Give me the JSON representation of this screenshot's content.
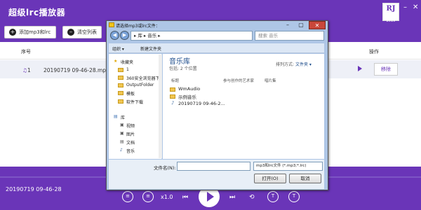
{
  "app": {
    "title": "超级lrc播放器",
    "logo": "RJ",
    "logo_year": "2019",
    "minimize": "–",
    "close": "✕"
  },
  "toolbar": {
    "add_label": "添加mp3和lrc",
    "clear_label": "清空列表"
  },
  "list": {
    "headers": {
      "index": "序号",
      "action": "操作"
    },
    "rows": [
      {
        "index": "1",
        "name": "20190719 09-46-28.mp3",
        "action": "移除"
      }
    ]
  },
  "player": {
    "now_playing": "20190719 09-46-28",
    "speed": "x1.0"
  },
  "dialog": {
    "title": "请选择mp3或lrc文件：",
    "nav_path": "▸ 库 ▸ 音乐 ▸",
    "search_placeholder": "搜索 音乐",
    "commands": {
      "organize": "组织 ▾",
      "new_folder": "新建文件夹"
    },
    "nav_items": {
      "favorites": "收藏夹",
      "item1": "1",
      "item2": "360安全浏览器下",
      "item3": "OutputFolder",
      "item4": "模板",
      "item5": "软件下载",
      "libraries": "库",
      "videos": "视频",
      "pictures": "图片",
      "documents": "文档",
      "music": "音乐"
    },
    "library_title": "音乐库",
    "library_sub": "包括: 2 个位置",
    "arrange_label": "排列方式:",
    "arrange_value": "文件夹 ▾",
    "columns": {
      "title": "标题",
      "artists": "参与创作的艺术家",
      "album": "唱片集"
    },
    "files": [
      "WmAudio",
      "示例音乐",
      "20190719 09-46-2..."
    ],
    "filename_label": "文件名(N):",
    "filetype": "mp3和lrc文件 (*.mp3;*.lrc)",
    "open_label": "打开(O)",
    "cancel_label": "取消"
  }
}
